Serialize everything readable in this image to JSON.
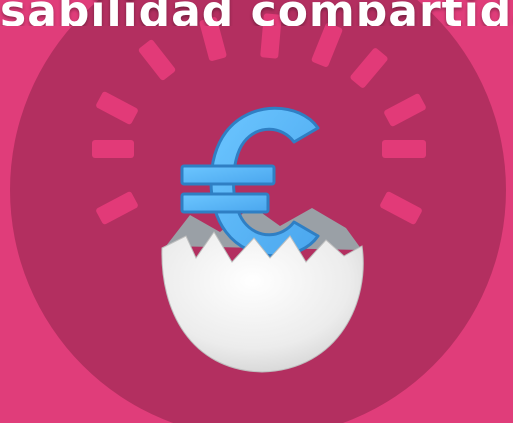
{
  "headline": {
    "text": "sabilidad compartida"
  },
  "colors": {
    "background": "#e03d7a",
    "circle": "#b32f60",
    "rays": "#e23a78",
    "euro": "#5fbcff",
    "shell": "#eeeeee",
    "shell_shadow": "#9aa0a6",
    "headline_text": "#ffffff"
  },
  "icons": {
    "main": "euro-icon",
    "shell": "cracked-eggshell-icon",
    "rays": "burst-rays"
  }
}
